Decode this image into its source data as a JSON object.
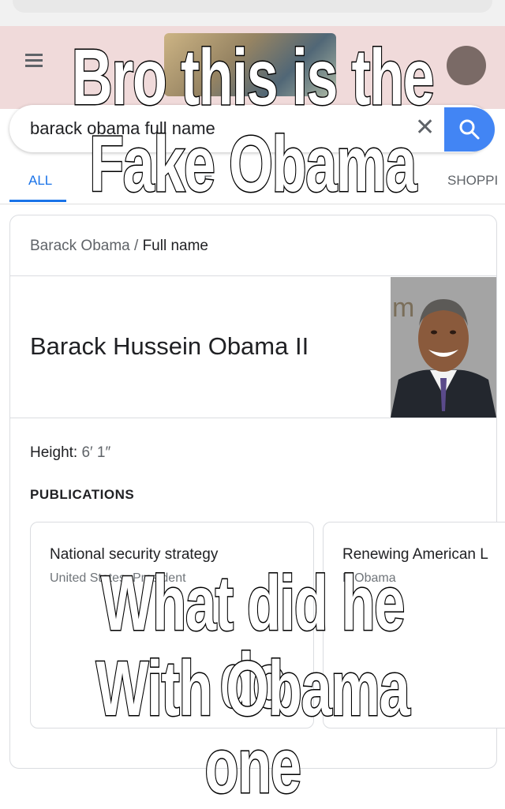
{
  "search": {
    "query": "barack obama full name",
    "clear_icon": "close-icon",
    "search_icon": "search-icon"
  },
  "tabs": {
    "all": "ALL",
    "images_partial": "E",
    "shopping_partial": "SHOPPI"
  },
  "knowledge_panel": {
    "breadcrumb_entity": "Barack Obama",
    "breadcrumb_separator": "/",
    "breadcrumb_attribute": "Full name",
    "answer": "Barack Hussein Obama II",
    "height_label": "Height:",
    "height_value": "6′ 1″",
    "publications_heading": "PUBLICATIONS",
    "publications": [
      {
        "title": "National security strategy",
        "author": "United States. President"
      },
      {
        "title": "Renewing American L",
        "author": "B Obama"
      }
    ]
  },
  "meme": {
    "top_line_1": "Bro this is the",
    "top_line_2": "Fake Obama",
    "bottom_line_1": "What did he do",
    "bottom_line_2": "With Obama one"
  },
  "colors": {
    "accent_blue": "#4285f4",
    "tab_blue": "#1a73e8",
    "header_pink": "#f0dada"
  }
}
